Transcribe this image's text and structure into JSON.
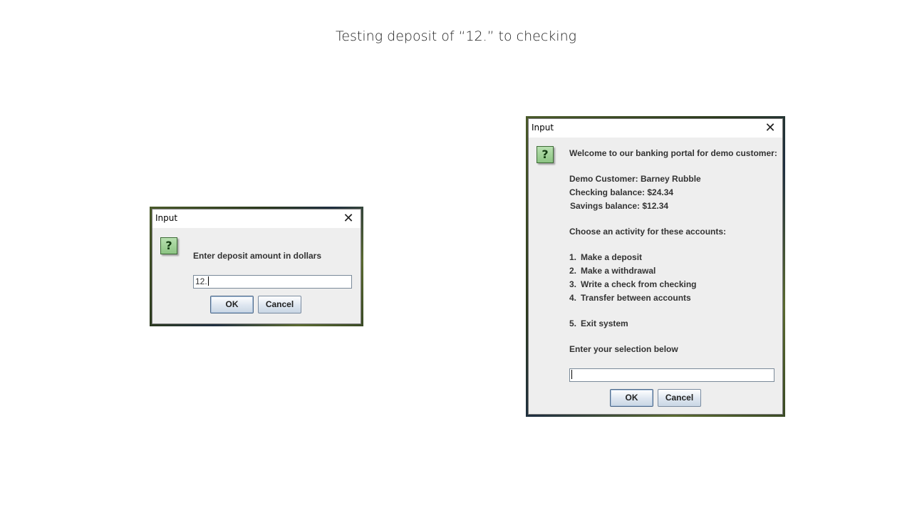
{
  "slide": {
    "title": "Testing deposit of “12.” to checking"
  },
  "deposit_dialog": {
    "title": "Input",
    "close_glyph": "✕",
    "icon": "question-icon",
    "icon_glyph": "?",
    "message": "Enter deposit amount in dollars",
    "input_value": "12.",
    "ok_label": "OK",
    "cancel_label": "Cancel"
  },
  "menu_dialog": {
    "title": "Input",
    "close_glyph": "✕",
    "icon": "question-icon",
    "icon_glyph": "?",
    "welcome": "Welcome to our banking portal for demo customer:",
    "customer_line": "Demo Customer:  Barney Rubble",
    "checking_line": "Checking balance: $24.34",
    "savings_line": "Savings balance:  $12.34",
    "choose_prompt": "Choose an activity for these accounts:",
    "options": [
      {
        "num": "1.",
        "label": "Make a deposit"
      },
      {
        "num": "2.",
        "label": "Make a withdrawal"
      },
      {
        "num": "3.",
        "label": "Write a check from checking"
      },
      {
        "num": "4.",
        "label": "Transfer between accounts"
      },
      {
        "num": "5.",
        "label": "Exit system"
      }
    ],
    "selection_prompt": "Enter your selection below",
    "input_value": "",
    "ok_label": "OK",
    "cancel_label": "Cancel"
  }
}
